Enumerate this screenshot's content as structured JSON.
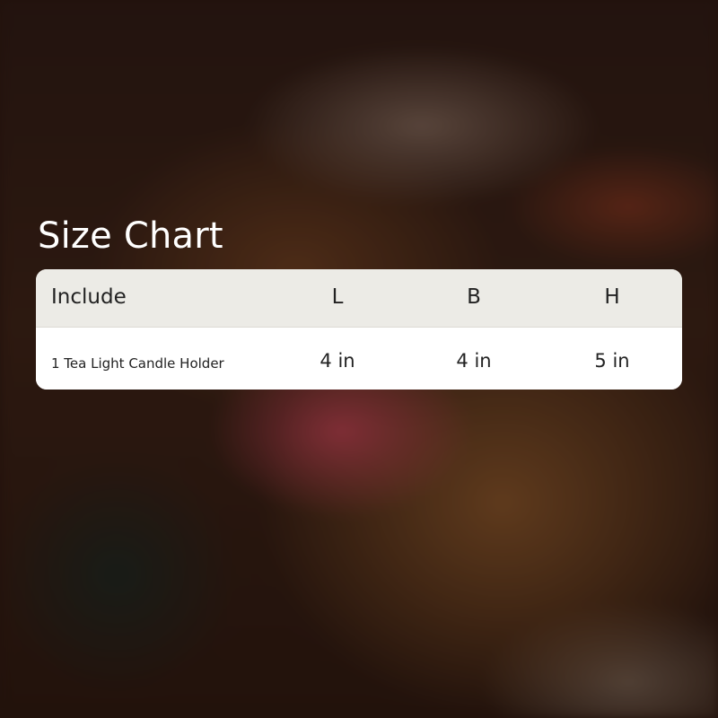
{
  "title": "Size Chart",
  "table": {
    "headers": [
      "Include",
      "L",
      "B",
      "H"
    ],
    "rows": [
      [
        "1 Tea Light Candle Holder",
        "4 in",
        "4 in",
        "5 in"
      ]
    ]
  },
  "colors": {
    "header_background": "#ecebe6",
    "row_background": "#ffffff",
    "title_text": "#ffffff",
    "table_text": "#222222"
  }
}
